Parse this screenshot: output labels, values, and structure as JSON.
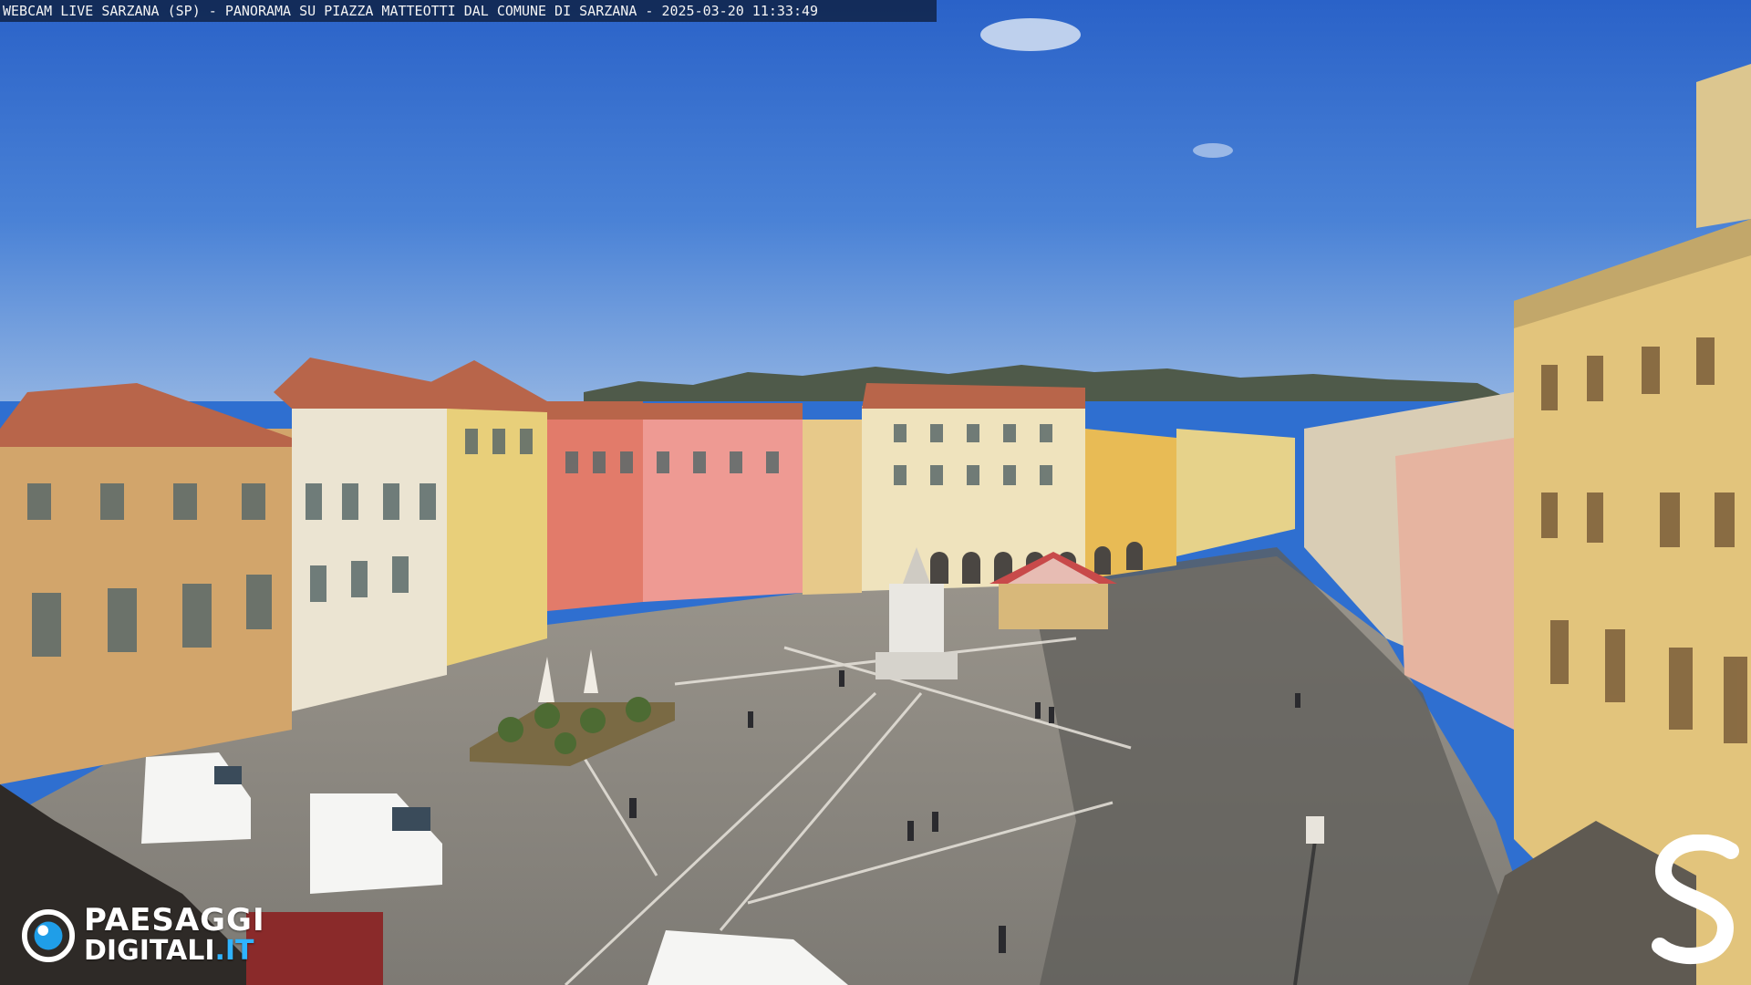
{
  "caption": {
    "text": "WEBCAM LIVE SARZANA (SP) - PANORAMA SU PIAZZA MATTEOTTI DAL COMUNE DI SARZANA - 2025-03-20   11:33:49"
  },
  "watermark": {
    "brand_line1": "PAESAGGI",
    "brand_line2_main": "DIGITALI",
    "brand_line2_tld": ".IT",
    "brand_icon": "eye-lens-icon",
    "corner_logo": "s-logo",
    "tld_color": "#2fb3ff"
  },
  "colors": {
    "sky_top": "#2a62c8",
    "sky_bottom": "#7fa8e0",
    "pavement": "#8a8780",
    "roof": "#b8654a"
  }
}
